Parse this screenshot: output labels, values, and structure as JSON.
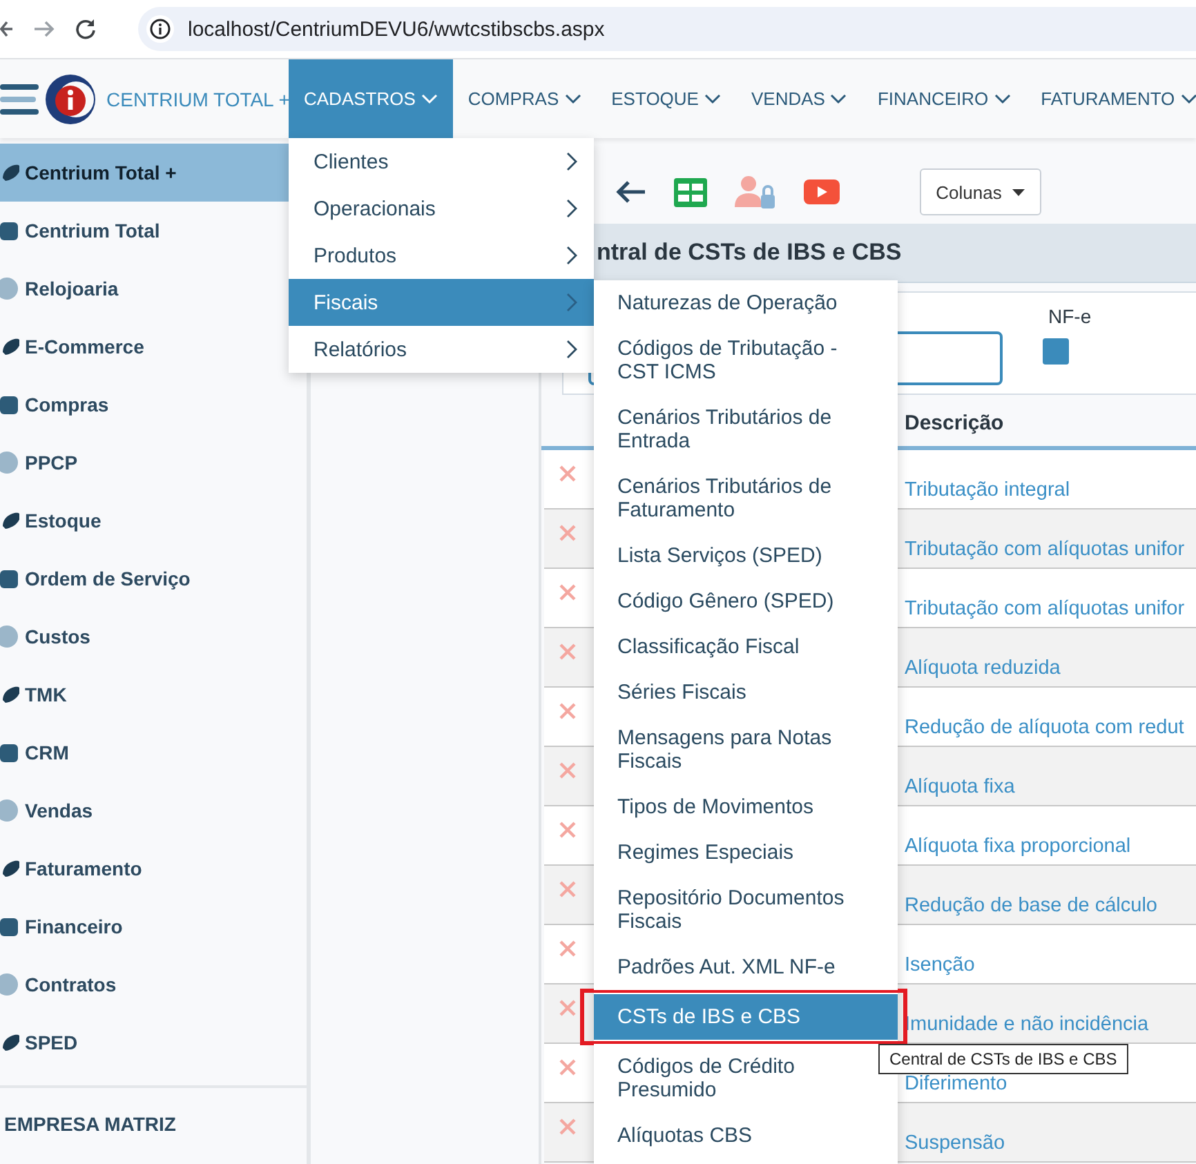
{
  "browser": {
    "url": "localhost/CentriumDEVU6/wwtcstibscbs.aspx"
  },
  "nav": {
    "app_name": "CENTRIUM TOTAL +",
    "items": [
      {
        "label": "CADASTROS",
        "selected": true
      },
      {
        "label": "COMPRAS",
        "selected": false
      },
      {
        "label": "ESTOQUE",
        "selected": false
      },
      {
        "label": "VENDAS",
        "selected": false
      },
      {
        "label": "FINANCEIRO",
        "selected": false
      },
      {
        "label": "FATURAMENTO",
        "selected": false
      }
    ]
  },
  "sidebar": {
    "items": [
      {
        "label": "Centrium Total +",
        "selected": true
      },
      {
        "label": "Centrium Total",
        "selected": false
      },
      {
        "label": "Relojoaria",
        "selected": false
      },
      {
        "label": "E-Commerce",
        "selected": false
      },
      {
        "label": "Compras",
        "selected": false
      },
      {
        "label": "PPCP",
        "selected": false
      },
      {
        "label": "Estoque",
        "selected": false
      },
      {
        "label": "Ordem de Serviço",
        "selected": false
      },
      {
        "label": "Custos",
        "selected": false
      },
      {
        "label": "TMK",
        "selected": false
      },
      {
        "label": "CRM",
        "selected": false
      },
      {
        "label": "Vendas",
        "selected": false
      },
      {
        "label": "Faturamento",
        "selected": false
      },
      {
        "label": "Financeiro",
        "selected": false
      },
      {
        "label": "Contratos",
        "selected": false
      },
      {
        "label": "SPED",
        "selected": false
      }
    ],
    "footer": "EMPRESA MATRIZ"
  },
  "toolbar": {
    "columns_button": "Colunas"
  },
  "page_title": "ntral de CSTs de IBS e CBS",
  "filters": {
    "nfe_label": "NF-e",
    "nfe_checked": true
  },
  "table": {
    "columns": [
      "Descrição"
    ],
    "rows": [
      {
        "descricao": "Tributação integral"
      },
      {
        "descricao": "Tributação com alíquotas unifor"
      },
      {
        "descricao": "Tributação com alíquotas unifor"
      },
      {
        "descricao": "Alíquota reduzida"
      },
      {
        "descricao": "Redução de alíquota com redut"
      },
      {
        "descricao": "Alíquota fixa"
      },
      {
        "descricao": "Alíquota fixa proporcional"
      },
      {
        "descricao": "Redução de base de cálculo"
      },
      {
        "descricao": "Isenção"
      },
      {
        "descricao": "Imunidade e não incidência"
      },
      {
        "descricao": "Diferimento"
      },
      {
        "descricao": "Suspensão"
      }
    ]
  },
  "menu": {
    "items": [
      {
        "label": "Clientes",
        "selected": false
      },
      {
        "label": "Operacionais",
        "selected": false
      },
      {
        "label": "Produtos",
        "selected": false
      },
      {
        "label": "Fiscais",
        "selected": true
      },
      {
        "label": "Relatórios",
        "selected": false
      }
    ]
  },
  "submenu": {
    "items": [
      {
        "label": "Naturezas de Operação",
        "selected": false,
        "annotated": false
      },
      {
        "label": "Códigos de Tributação - CST ICMS",
        "selected": false,
        "annotated": false
      },
      {
        "label": "Cenários Tributários de Entrada",
        "selected": false,
        "annotated": false
      },
      {
        "label": "Cenários Tributários de Faturamento",
        "selected": false,
        "annotated": false
      },
      {
        "label": "Lista Serviços (SPED)",
        "selected": false,
        "annotated": false
      },
      {
        "label": "Código Gênero (SPED)",
        "selected": false,
        "annotated": false
      },
      {
        "label": "Classificação Fiscal",
        "selected": false,
        "annotated": false
      },
      {
        "label": "Séries Fiscais",
        "selected": false,
        "annotated": false
      },
      {
        "label": "Mensagens para Notas Fiscais",
        "selected": false,
        "annotated": false
      },
      {
        "label": "Tipos de Movimentos",
        "selected": false,
        "annotated": false
      },
      {
        "label": "Regimes Especiais",
        "selected": false,
        "annotated": false
      },
      {
        "label": "Repositório Documentos Fiscais",
        "selected": false,
        "annotated": false
      },
      {
        "label": "Padrões Aut. XML NF-e",
        "selected": false,
        "annotated": false
      },
      {
        "label": "CSTs de IBS e CBS",
        "selected": true,
        "annotated": true
      },
      {
        "label": "Códigos de Crédito Presumido",
        "selected": false,
        "annotated": false
      },
      {
        "label": "Alíquotas CBS",
        "selected": false,
        "annotated": false
      }
    ]
  },
  "tooltip": "Central de CSTs de IBS e CBS"
}
